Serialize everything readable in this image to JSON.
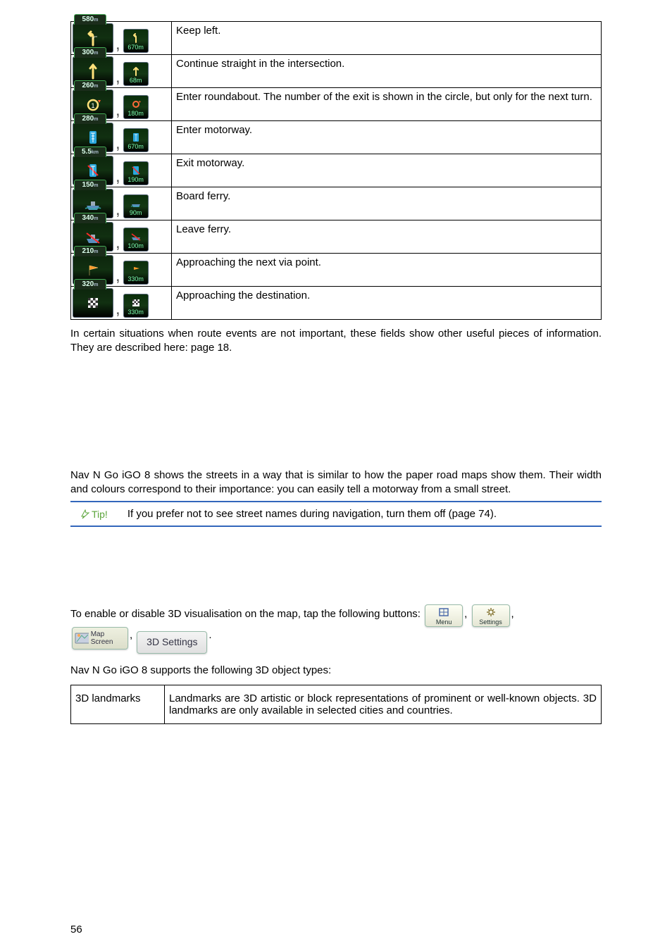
{
  "icon_rows": [
    {
      "main_dist": "580",
      "main_unit": "m",
      "small_dist": "670m",
      "desc": "Keep left."
    },
    {
      "main_dist": "300",
      "main_unit": "m",
      "small_dist": "68m",
      "desc": "Continue straight in the intersection."
    },
    {
      "main_dist": "260",
      "main_unit": "m",
      "small_dist": "180m",
      "desc": "Enter roundabout. The number of the exit is shown in the circle, but only for the next turn."
    },
    {
      "main_dist": "280",
      "main_unit": "m",
      "small_dist": "670m",
      "desc": "Enter motorway."
    },
    {
      "main_dist": "5.5",
      "main_unit": "km",
      "small_dist": "190m",
      "desc": "Exit motorway."
    },
    {
      "main_dist": "150",
      "main_unit": "m",
      "small_dist": "90m",
      "desc": "Board ferry."
    },
    {
      "main_dist": "340",
      "main_unit": "m",
      "small_dist": "100m",
      "desc": "Leave ferry."
    },
    {
      "main_dist": "210",
      "main_unit": "m",
      "small_dist": "330m",
      "desc": "Approaching the next via point."
    },
    {
      "main_dist": "320",
      "main_unit": "m",
      "small_dist": "330m",
      "desc": "Approaching the destination."
    }
  ],
  "para1": "In certain situations when route events are not important, these fields show other useful pieces of information. They are described here: page 18.",
  "para2": "Nav N Go iGO 8 shows the streets in a way that is similar to how the paper road maps show them. Their width and colours correspond to their importance: you can easily tell a motorway from a small street.",
  "tip_label": "Tip!",
  "tip_text": "If you prefer not to see street names during navigation, turn them off (page 74).",
  "btn_intro": "To enable or disable 3D visualisation on the map, tap the following buttons:",
  "btn_menu": "Menu",
  "btn_settings": "Settings",
  "btn_mapscreen": "Map Screen",
  "btn_3dsettings": "3D Settings",
  "btn_sep": ", ",
  "btn_after1": ",",
  "btn_after2": ".",
  "para3": "Nav N Go iGO 8 supports the following 3D object types:",
  "landmark_name": "3D landmarks",
  "landmark_desc": "Landmarks are 3D artistic or block representations of prominent or well-known objects. 3D landmarks are only available in selected cities and countries.",
  "page_number": "56"
}
